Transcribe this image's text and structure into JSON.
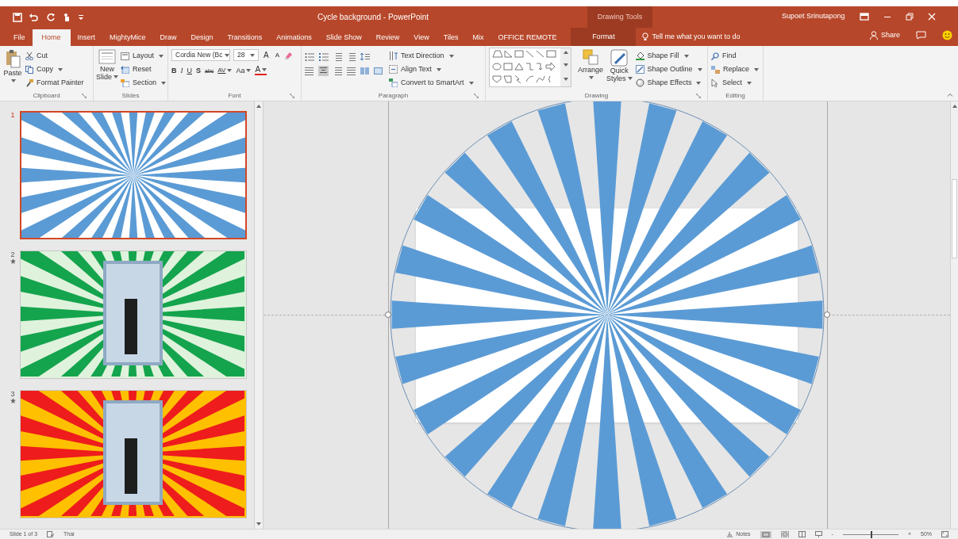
{
  "window": {
    "title": "Cycle background  -  PowerPoint",
    "context_group": "Drawing Tools",
    "user": "Supoet Srinutapong"
  },
  "tabs": [
    {
      "label": "File",
      "selected": false,
      "kind": "normal"
    },
    {
      "label": "Home",
      "selected": true,
      "kind": "normal"
    },
    {
      "label": "Insert",
      "selected": false,
      "kind": "normal"
    },
    {
      "label": "MightyMice",
      "selected": false,
      "kind": "normal"
    },
    {
      "label": "Draw",
      "selected": false,
      "kind": "normal"
    },
    {
      "label": "Design",
      "selected": false,
      "kind": "normal"
    },
    {
      "label": "Transitions",
      "selected": false,
      "kind": "normal"
    },
    {
      "label": "Animations",
      "selected": false,
      "kind": "normal"
    },
    {
      "label": "Slide Show",
      "selected": false,
      "kind": "normal"
    },
    {
      "label": "Review",
      "selected": false,
      "kind": "normal"
    },
    {
      "label": "View",
      "selected": false,
      "kind": "normal"
    },
    {
      "label": "Tiles",
      "selected": false,
      "kind": "normal"
    },
    {
      "label": "Mix",
      "selected": false,
      "kind": "normal"
    },
    {
      "label": "OFFICE REMOTE",
      "selected": false,
      "kind": "normal"
    },
    {
      "label": "Format",
      "selected": false,
      "kind": "contextual"
    }
  ],
  "tell_me": {
    "placeholder": "Tell me what you want to do"
  },
  "share": "Share",
  "ribbon": {
    "clipboard": {
      "name": "Clipboard",
      "paste": "Paste",
      "items": [
        "Cut",
        "Copy",
        "Format Painter"
      ]
    },
    "slides": {
      "name": "Slides",
      "new_slide": [
        "New",
        "Slide"
      ],
      "items": [
        "Layout",
        "Reset",
        "Section"
      ]
    },
    "font": {
      "name": "Font",
      "font_name": "Cordia New (Bc",
      "font_size": "28",
      "grow": "A",
      "shrink": "A",
      "format_buttons": [
        "B",
        "I",
        "U",
        "S",
        "abc",
        "AV",
        "Aa",
        "A"
      ]
    },
    "paragraph": {
      "name": "Paragraph",
      "items": [
        "Text Direction",
        "Align Text",
        "Convert to SmartArt"
      ]
    },
    "drawing": {
      "name": "Drawing",
      "arrange": "Arrange",
      "quick_styles": [
        "Quick",
        "Styles"
      ],
      "items": [
        "Shape Fill",
        "Shape Outline",
        "Shape Effects"
      ]
    },
    "editing": {
      "name": "Editing",
      "items": [
        "Find",
        "Replace",
        "Select"
      ]
    }
  },
  "slides": [
    {
      "number": "1",
      "selected": true,
      "transition": false,
      "kind": "plain",
      "color": "#5b9bd5",
      "background": {
        "color": "#ffffff"
      }
    },
    {
      "number": "2",
      "selected": false,
      "transition": true,
      "kind": "photo",
      "color": "#14a44d",
      "background": {
        "color": "#dff2dc"
      }
    },
    {
      "number": "3",
      "selected": false,
      "transition": true,
      "kind": "photo",
      "color": "#ee1c1c",
      "background": {
        "color": "#ffc000"
      }
    }
  ],
  "status_bar": {
    "slide": "Slide 1 of 3",
    "language": "Thai",
    "notes": "Notes",
    "zoom_out": "-",
    "zoom_in": "+",
    "zoom": "50%",
    "zoom_level": {
      "level": 0.5
    }
  }
}
